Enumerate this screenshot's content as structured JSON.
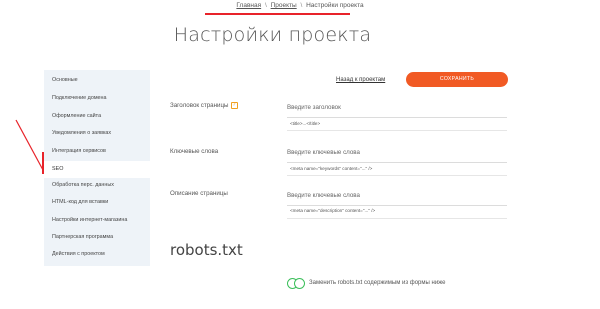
{
  "breadcrumb": {
    "home": "Главная",
    "sep1": "\\",
    "projects": "Проекты",
    "sep2": "\\",
    "current": "Настройки проекта"
  },
  "page_title": "Настройки проекта",
  "sidebar": {
    "items": [
      {
        "label": "Основные"
      },
      {
        "label": "Подключение домена"
      },
      {
        "label": "Оформление сайта"
      },
      {
        "label": "Уведомления о заявках"
      },
      {
        "label": "Интеграция сервисов"
      },
      {
        "label": "SEO"
      },
      {
        "label": "Обработка перс. данных"
      },
      {
        "label": "HTML-код для вставки"
      },
      {
        "label": "Настройки интернет-магазина"
      },
      {
        "label": "Партнерская программа"
      },
      {
        "label": "Действия с проектом"
      }
    ]
  },
  "header_actions": {
    "back_label": "Назад к проектам",
    "save_label": "СОХРАНИТЬ"
  },
  "fields": {
    "title": {
      "label": "Заголовок страницы",
      "help_icon": "?",
      "placeholder": "Введите заголовок",
      "hint": "<title>...</title>"
    },
    "keywords": {
      "label": "Ключевые слова",
      "placeholder": "Введите ключевые слова",
      "hint": "<meta name=\"keywords\" content=\"...\" />"
    },
    "description": {
      "label": "Описание страницы",
      "placeholder": "Введите ключевые слова",
      "hint": "<meta name=\"description\" content=\"...\" />"
    }
  },
  "robots": {
    "title": "robots.txt",
    "toggle_label": "Заменить robots.txt содержимым из формы ниже"
  },
  "colors": {
    "accent": "#f15a24",
    "annotation": "#e8232a",
    "toggle": "#3bbf5a",
    "sidebar_bg": "#eef3f8"
  }
}
